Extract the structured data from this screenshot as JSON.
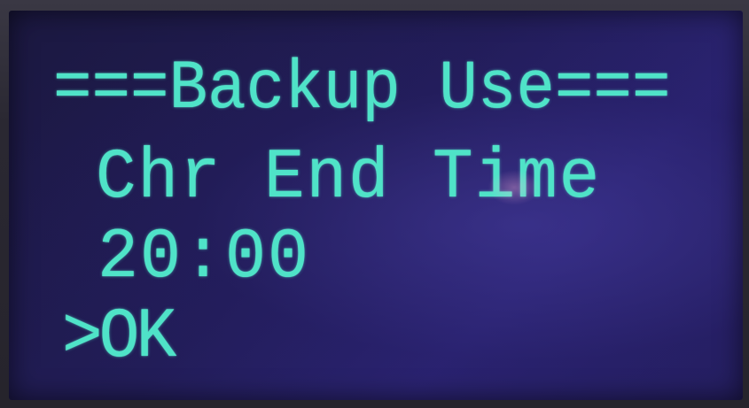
{
  "display": {
    "header": "===Backup Use===",
    "setting_label": "Chr End Time",
    "setting_value": "20:00",
    "menu_option": ">OK"
  },
  "colors": {
    "text": "#4fe3c8",
    "background": "#221d58",
    "bezel": "#2c2a33"
  }
}
